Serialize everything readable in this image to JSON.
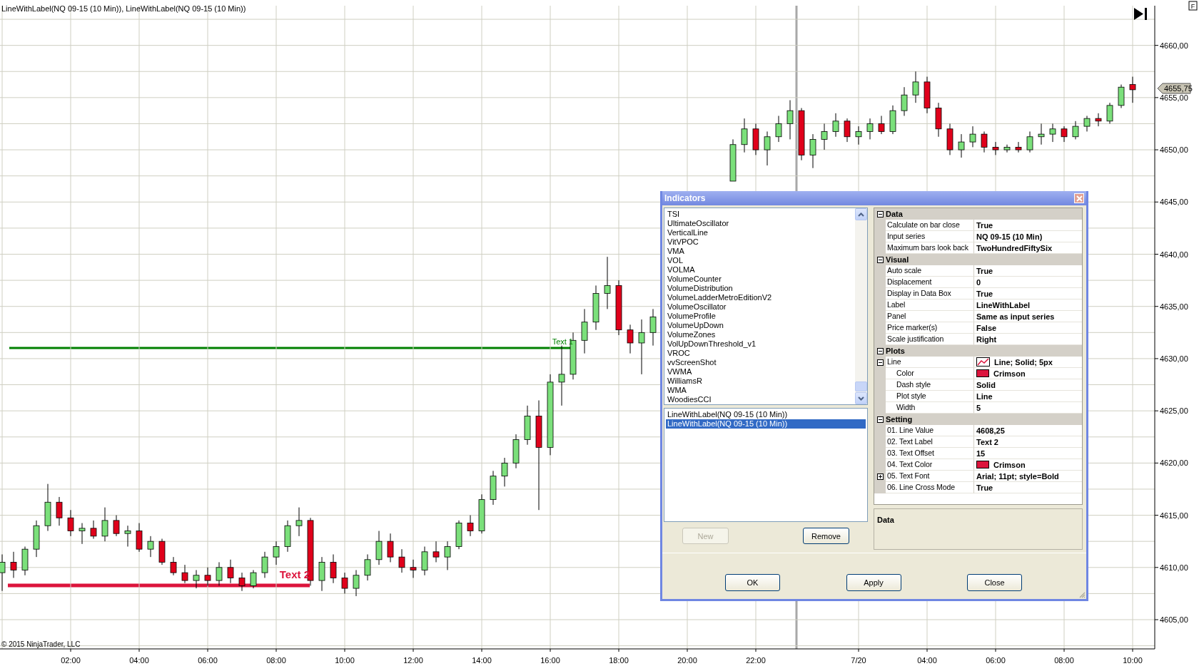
{
  "chart": {
    "title": "LineWithLabel(NQ 09-15 (10 Min)), LineWithLabel(NQ 09-15 (10 Min))",
    "chart_data": {
      "type": "candlestick",
      "ylim": [
        4602.2,
        4663.8
      ],
      "yticks": [
        {
          "value": 4660,
          "label": "4660,00"
        },
        {
          "value": 4655,
          "label": "4655,00"
        },
        {
          "value": 4650,
          "label": "4650,00"
        },
        {
          "value": 4645,
          "label": "4645,00"
        },
        {
          "value": 4640,
          "label": "4640,00"
        },
        {
          "value": 4635,
          "label": "4635,00"
        },
        {
          "value": 4630,
          "label": "4630,00"
        },
        {
          "value": 4625,
          "label": "4625,00"
        },
        {
          "value": 4620,
          "label": "4620,00"
        },
        {
          "value": 4615,
          "label": "4615,00"
        },
        {
          "value": 4610,
          "label": "4610,00"
        },
        {
          "value": 4605,
          "label": "4605,00"
        }
      ],
      "grid": true,
      "categories": [
        null,
        null,
        null,
        null,
        null,
        null,
        "02:00",
        null,
        null,
        null,
        null,
        null,
        "04:00",
        null,
        null,
        null,
        null,
        null,
        "06:00",
        null,
        null,
        null,
        null,
        null,
        "08:00",
        null,
        null,
        null,
        null,
        null,
        "10:00",
        null,
        null,
        null,
        null,
        null,
        "12:00",
        null,
        null,
        null,
        null,
        null,
        "14:00",
        null,
        null,
        null,
        null,
        null,
        "16:00",
        null,
        null,
        null,
        null,
        null,
        "18:00",
        null,
        null,
        null,
        null,
        null,
        "20:00",
        null,
        null,
        null,
        null,
        null,
        "22:00",
        null,
        null,
        null,
        null,
        null,
        null,
        null,
        null,
        "7/20",
        null,
        null,
        null,
        null,
        null,
        "04:00",
        null,
        null,
        null,
        null,
        null,
        "06:00",
        null,
        null,
        null,
        null,
        null,
        "08:00",
        null,
        null,
        null,
        null,
        null,
        "10:00"
      ],
      "ohlc": [
        [
          4609.5,
          4611.25,
          4607.75,
          4610.5
        ],
        [
          4610.5,
          4611.5,
          4609,
          4609.75
        ],
        [
          4609.75,
          4612,
          4609.25,
          4611.75
        ],
        [
          4611.75,
          4614.5,
          4611,
          4614
        ],
        [
          4614,
          4618,
          4613.5,
          4616.25
        ],
        [
          4616.25,
          4616.75,
          4614,
          4614.75
        ],
        [
          4614.75,
          4615.5,
          4613,
          4613.5
        ],
        [
          4613.5,
          4614.25,
          4612.25,
          4613.75
        ],
        [
          4613.75,
          4614.5,
          4612.75,
          4613
        ],
        [
          4613,
          4615.75,
          4612.5,
          4614.5
        ],
        [
          4614.5,
          4615,
          4613,
          4613.25
        ],
        [
          4613.25,
          4614,
          4612,
          4613.5
        ],
        [
          4613.5,
          4614.25,
          4611.5,
          4611.75
        ],
        [
          4611.75,
          4613,
          4611,
          4612.5
        ],
        [
          4612.5,
          4612.75,
          4610.25,
          4610.5
        ],
        [
          4610.5,
          4611,
          4609.25,
          4609.5
        ],
        [
          4609.5,
          4610.25,
          4608.5,
          4608.75
        ],
        [
          4608.75,
          4609.75,
          4608,
          4609.25
        ],
        [
          4609.25,
          4610,
          4608.25,
          4608.75
        ],
        [
          4608.75,
          4610.5,
          4608.25,
          4610
        ],
        [
          4610,
          4610.75,
          4608.5,
          4609
        ],
        [
          4609,
          4609.5,
          4607.75,
          4608.25
        ],
        [
          4608.25,
          4609.75,
          4608,
          4609.5
        ],
        [
          4609.5,
          4611.5,
          4609,
          4611
        ],
        [
          4611,
          4612.5,
          4610.25,
          4612
        ],
        [
          4612,
          4614.5,
          4611.5,
          4614
        ],
        [
          4614,
          4615.75,
          4613,
          4614.5
        ],
        [
          4614.5,
          4614.75,
          4608.25,
          4608.75
        ],
        [
          4608.75,
          4611,
          4607.75,
          4610.5
        ],
        [
          4610.5,
          4611.25,
          4608.5,
          4609
        ],
        [
          4609,
          4609.5,
          4607.5,
          4608
        ],
        [
          4608,
          4609.75,
          4607.25,
          4609.25
        ],
        [
          4609.25,
          4611.25,
          4608.75,
          4610.75
        ],
        [
          4610.75,
          4613.5,
          4610.25,
          4612.5
        ],
        [
          4612.5,
          4613.25,
          4610.5,
          4611
        ],
        [
          4611,
          4611.75,
          4609.5,
          4610
        ],
        [
          4610,
          4610.75,
          4609,
          4609.75
        ],
        [
          4609.75,
          4612,
          4609.25,
          4611.5
        ],
        [
          4611.5,
          4612.5,
          4610.5,
          4611
        ],
        [
          4611,
          4612.5,
          4609.75,
          4612
        ],
        [
          4612,
          4614.5,
          4611.75,
          4614.25
        ],
        [
          4614.25,
          4615,
          4613,
          4613.5
        ],
        [
          4613.5,
          4617,
          4613.25,
          4616.5
        ],
        [
          4616.5,
          4619.25,
          4616,
          4618.75
        ],
        [
          4618.75,
          4620.5,
          4617.75,
          4620
        ],
        [
          4620,
          4622.75,
          4619.5,
          4622.25
        ],
        [
          4622.25,
          4625.5,
          4621.75,
          4624.5
        ],
        [
          4624.5,
          4626,
          4615.5,
          4621.5
        ],
        [
          4621.5,
          4628.5,
          4620.75,
          4627.75
        ],
        [
          4627.75,
          4631.25,
          4625.5,
          4628.5
        ],
        [
          4628.5,
          4632.5,
          4628,
          4631.75
        ],
        [
          4631.75,
          4634.75,
          4630.5,
          4633.5
        ],
        [
          4633.5,
          4637,
          4632.75,
          4636.25
        ],
        [
          4636.25,
          4639.75,
          4634.75,
          4637
        ],
        [
          4637,
          4637.5,
          4632.25,
          4632.75
        ],
        [
          4632.75,
          4633.25,
          4630.5,
          4631.5
        ],
        [
          4631.5,
          4633.75,
          4628.5,
          4632.5
        ],
        [
          4632.5,
          4634.75,
          4631.25,
          4634
        ],
        null,
        null,
        null,
        null,
        null,
        null,
        [
          4647,
          4651,
          4647,
          4650.5
        ],
        [
          4650.5,
          4653,
          4649.75,
          4652
        ],
        [
          4652,
          4652.5,
          4649.5,
          4650
        ],
        [
          4650,
          4651.75,
          4648.5,
          4651.25
        ],
        [
          4651.25,
          4653.25,
          4650.75,
          4652.5
        ],
        [
          4652.5,
          4654.75,
          4651,
          4653.75
        ],
        [
          4653.75,
          4654,
          4649,
          4649.5
        ],
        [
          4649.5,
          4651.5,
          4648.25,
          4651
        ],
        [
          4651,
          4652.5,
          4650,
          4651.75
        ],
        [
          4651.75,
          4653.5,
          4651.25,
          4652.75
        ],
        [
          4652.75,
          4653,
          4650.75,
          4651.25
        ],
        [
          4651.25,
          4652.25,
          4650.5,
          4651.75
        ],
        [
          4651.75,
          4653,
          4651,
          4652.5
        ],
        [
          4652.5,
          4653.25,
          4651.5,
          4651.75
        ],
        [
          4651.75,
          4654.25,
          4651.5,
          4653.75
        ],
        [
          4653.75,
          4656,
          4653.25,
          4655.25
        ],
        [
          4655.25,
          4657.5,
          4654.5,
          4656.5
        ],
        [
          4656.5,
          4657,
          4653.5,
          4654
        ],
        [
          4654,
          4654.5,
          4651.25,
          4652
        ],
        [
          4652,
          4652.5,
          4649.5,
          4650
        ],
        [
          4650,
          4651.5,
          4649.25,
          4650.75
        ],
        [
          4650.75,
          4652.25,
          4650.25,
          4651.5
        ],
        [
          4651.5,
          4651.75,
          4649.75,
          4650.25
        ],
        [
          4650.25,
          4650.75,
          4649.5,
          4650
        ],
        [
          4650,
          4650.5,
          4649.75,
          4650.25
        ],
        [
          4650.25,
          4650.75,
          4649.75,
          4650
        ],
        [
          4650,
          4651.75,
          4649.75,
          4651.25
        ],
        [
          4651.25,
          4652.5,
          4650.5,
          4651.5
        ],
        [
          4651.5,
          4652.5,
          4650.75,
          4652
        ],
        [
          4652,
          4652.25,
          4650.75,
          4651.25
        ],
        [
          4651.25,
          4652.75,
          4651,
          4652.25
        ],
        [
          4652.25,
          4653.25,
          4651.75,
          4653
        ],
        [
          4653,
          4653.5,
          4652.25,
          4652.75
        ],
        [
          4652.75,
          4654.5,
          4652.5,
          4654.25
        ],
        [
          4654.25,
          4656.25,
          4654,
          4656
        ],
        [
          4656.25,
          4657,
          4654.5,
          4655.75
        ]
      ]
    },
    "price_marker": "4655,75",
    "corner_button": "F",
    "copyright": "© 2015 NinjaTrader, LLC",
    "lines": [
      {
        "label": "Text 1",
        "color": "#008000",
        "kind": "plain"
      },
      {
        "label": "Text 2",
        "color": "#dc143c",
        "kind": "bold"
      }
    ]
  },
  "dialog": {
    "title": "Indicators",
    "available": [
      "TSI",
      "UltimateOscillator",
      "VerticalLine",
      "VitVPOC",
      "VMA",
      "VOL",
      "VOLMA",
      "VolumeCounter",
      "VolumeDistribution",
      "VolumeLadderMetroEditionV2",
      "VolumeOscillator",
      "VolumeProfile",
      "VolumeUpDown",
      "VolumeZones",
      "VolUpDownThreshold_v1",
      "VROC",
      "vvScreenShot",
      "VWMA",
      "WilliamsR",
      "WMA",
      "WoodiesCCI"
    ],
    "applied": [
      {
        "label": "LineWithLabel(NQ 09-15 (10 Min))",
        "selected": false
      },
      {
        "label": "LineWithLabel(NQ 09-15 (10 Min))",
        "selected": true
      }
    ],
    "list_buttons": [
      {
        "label": "New",
        "disabled": true
      },
      {
        "label": "Remove",
        "disabled": false
      }
    ],
    "properties": [
      {
        "category": "Data",
        "expanded": true,
        "rows": [
          {
            "name": "Calculate on bar close",
            "value": "True"
          },
          {
            "name": "Input series",
            "value": "NQ 09-15 (10 Min)"
          },
          {
            "name": "Maximum bars look back",
            "value": "TwoHundredFiftySix"
          }
        ]
      },
      {
        "category": "Visual",
        "expanded": true,
        "rows": [
          {
            "name": "Auto scale",
            "value": "True"
          },
          {
            "name": "Displacement",
            "value": "0"
          },
          {
            "name": "Display in Data Box",
            "value": "True"
          },
          {
            "name": "Label",
            "value": "LineWithLabel"
          },
          {
            "name": "Panel",
            "value": "Same as input series"
          },
          {
            "name": "Price marker(s)",
            "value": "False"
          },
          {
            "name": "Scale justification",
            "value": "Right"
          }
        ]
      },
      {
        "category": "Plots",
        "expanded": true,
        "rows": [
          {
            "name": "Line",
            "value": "Line; Solid; 5px",
            "kind": "line-style",
            "expanded": true,
            "children": [
              {
                "name": "Color",
                "value": "Crimson",
                "color": "#dc143c"
              },
              {
                "name": "Dash style",
                "value": "Solid"
              },
              {
                "name": "Plot style",
                "value": "Line"
              },
              {
                "name": "Width",
                "value": "5"
              }
            ]
          }
        ]
      },
      {
        "category": "Setting",
        "expanded": true,
        "rows": [
          {
            "name": "01. Line Value",
            "value": "4608,25"
          },
          {
            "name": "02. Text Label",
            "value": "Text 2"
          },
          {
            "name": "03. Text Offset",
            "value": "15"
          },
          {
            "name": "04. Text Color",
            "value": "Crimson",
            "color": "#dc143c"
          },
          {
            "name": "05. Text Font",
            "value": "Arial; 11pt; style=Bold",
            "expanded": false
          },
          {
            "name": "06. Line Cross Mode",
            "value": "True"
          }
        ]
      }
    ],
    "description": {
      "title": "Data"
    },
    "buttons": [
      "OK",
      "Apply",
      "Close"
    ]
  }
}
